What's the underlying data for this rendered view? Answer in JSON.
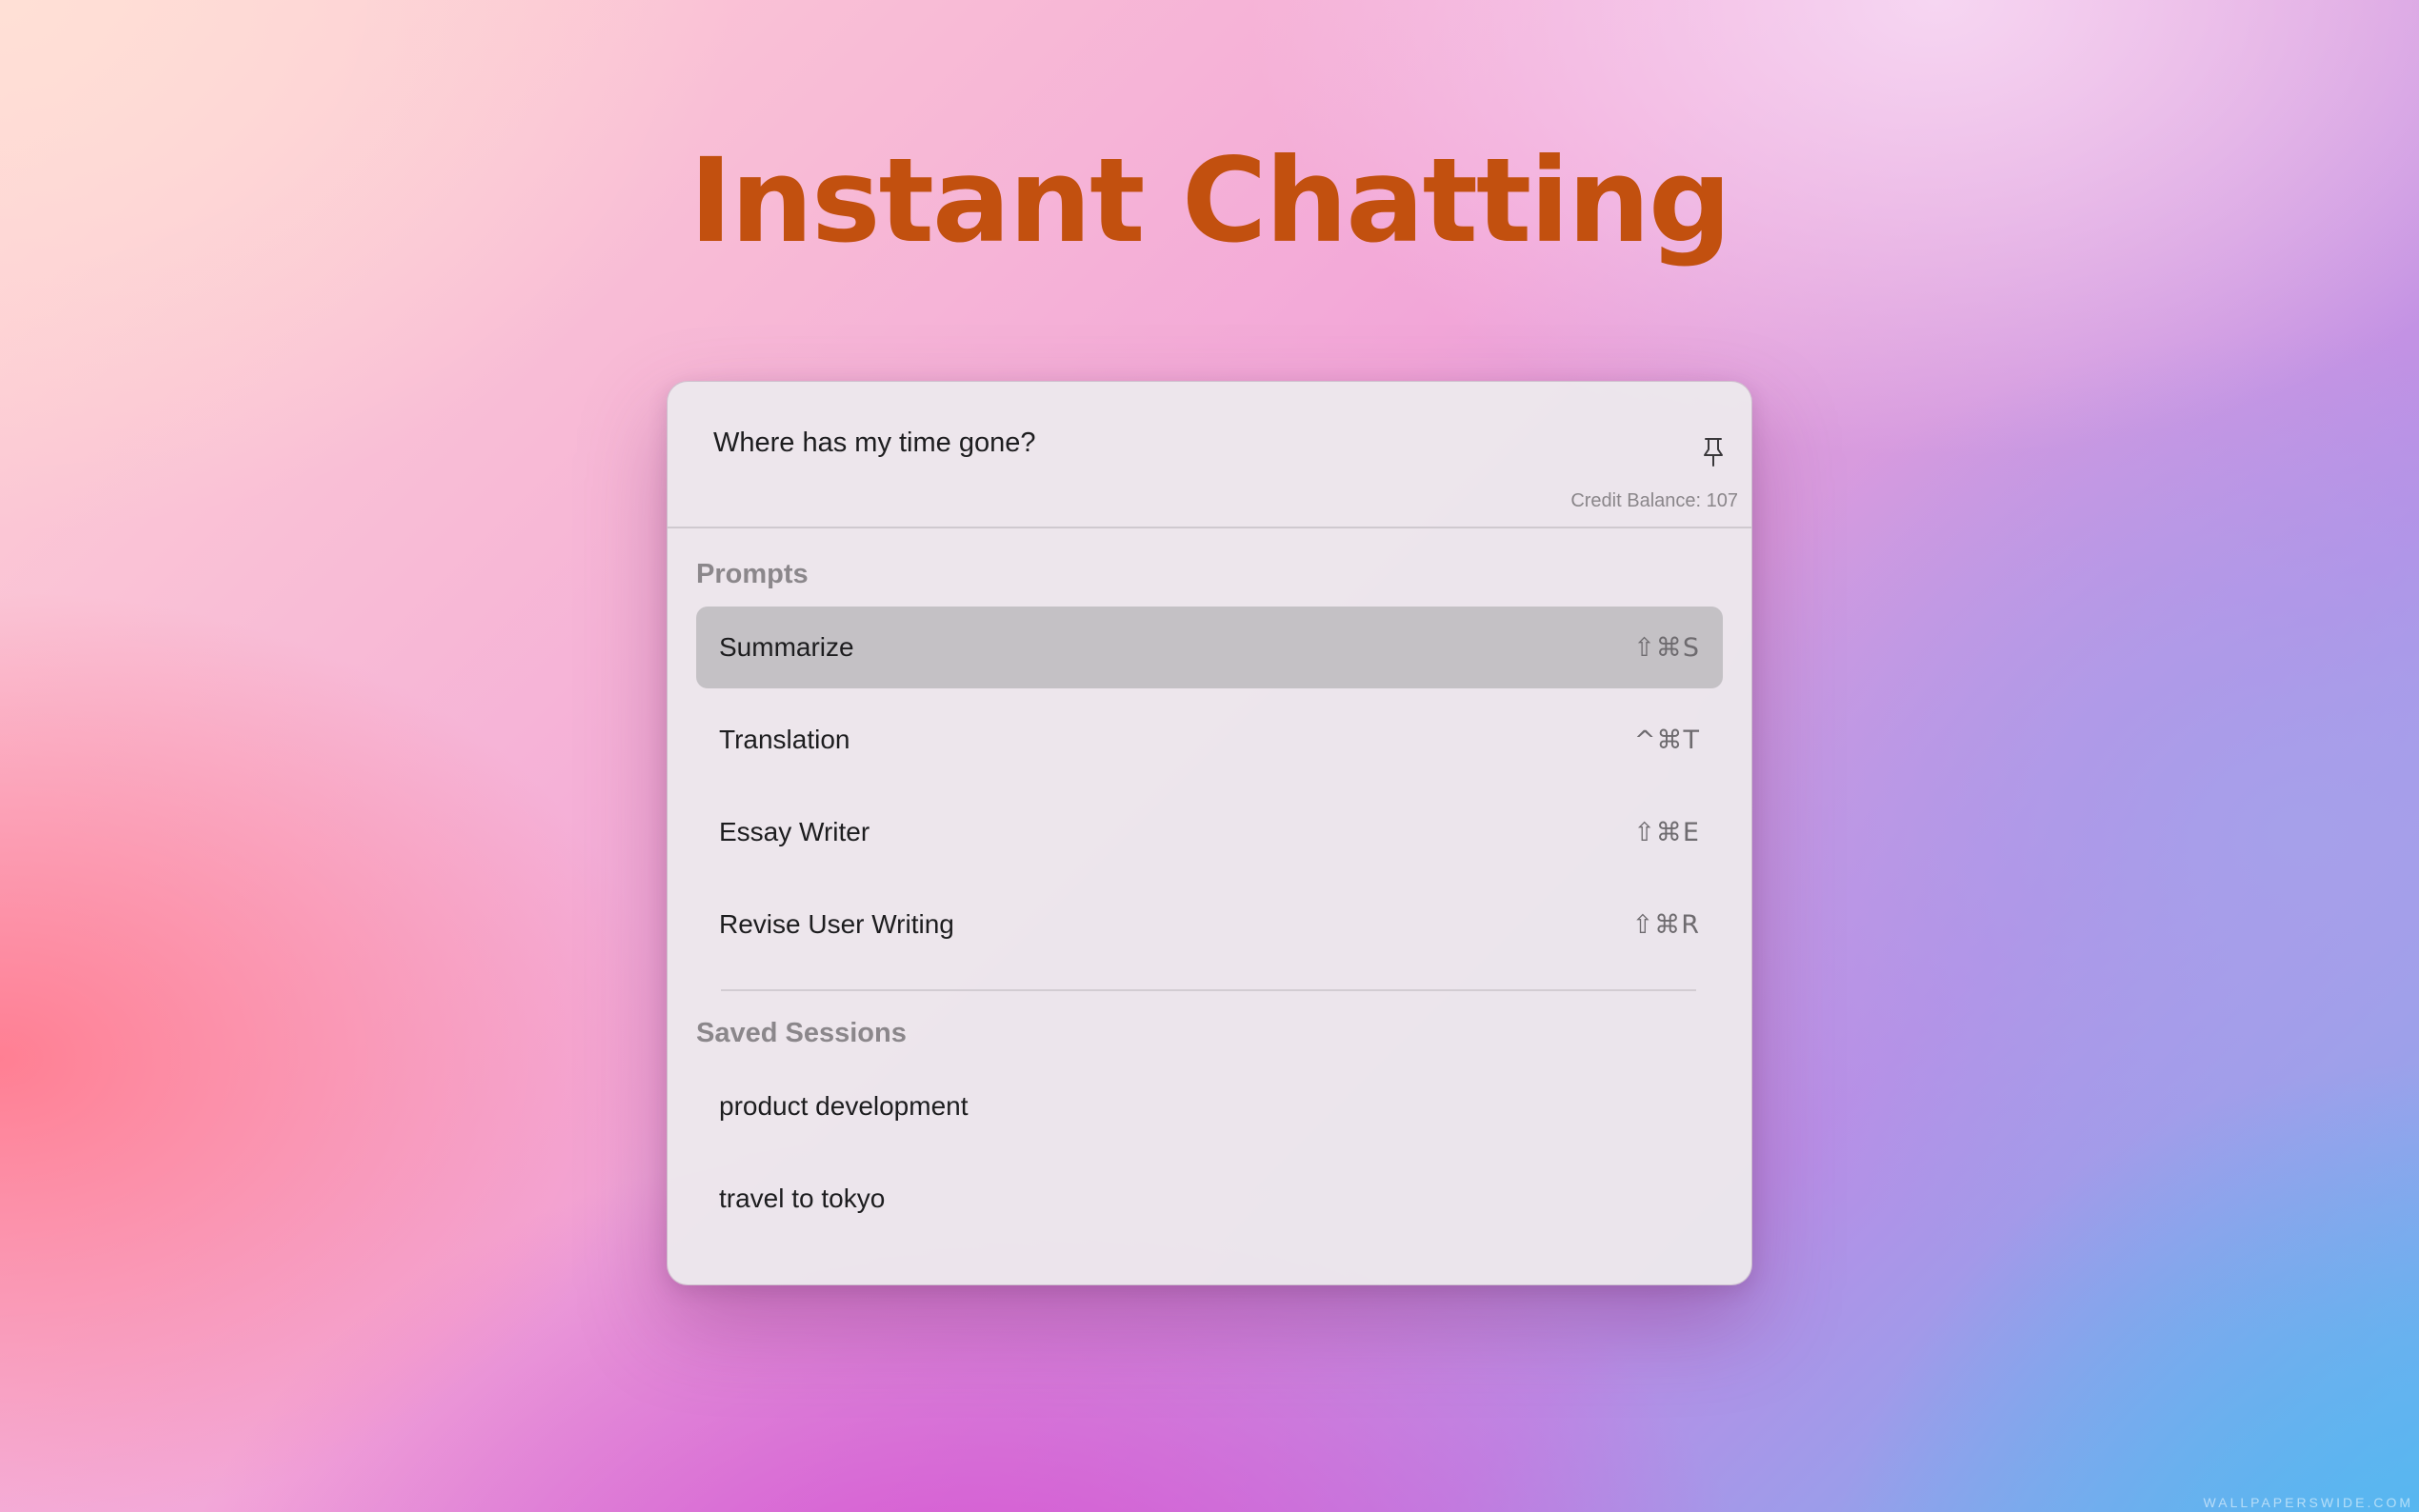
{
  "page": {
    "headline": "Instant Chatting",
    "headline_color": "#c2500f",
    "watermark": "WALLPAPERSWIDE.COM"
  },
  "search": {
    "query": "Where has my time gone?",
    "pin_icon": "pin-icon",
    "credit_balance": "Credit Balance: 107"
  },
  "prompts": {
    "title": "Prompts",
    "items": [
      {
        "label": "Summarize",
        "shortcut": "⇧⌘S",
        "selected": true
      },
      {
        "label": "Translation",
        "shortcut": "^⌘T",
        "selected": false
      },
      {
        "label": "Essay Writer",
        "shortcut": "⇧⌘E",
        "selected": false
      },
      {
        "label": "Revise User Writing",
        "shortcut": "⇧⌘R",
        "selected": false
      }
    ]
  },
  "sessions": {
    "title": "Saved Sessions",
    "items": [
      {
        "label": "product development"
      },
      {
        "label": "travel to tokyo"
      }
    ]
  },
  "colors": {
    "selected_row": "#c4c1c5",
    "panel_bg": "#ece8ec"
  }
}
